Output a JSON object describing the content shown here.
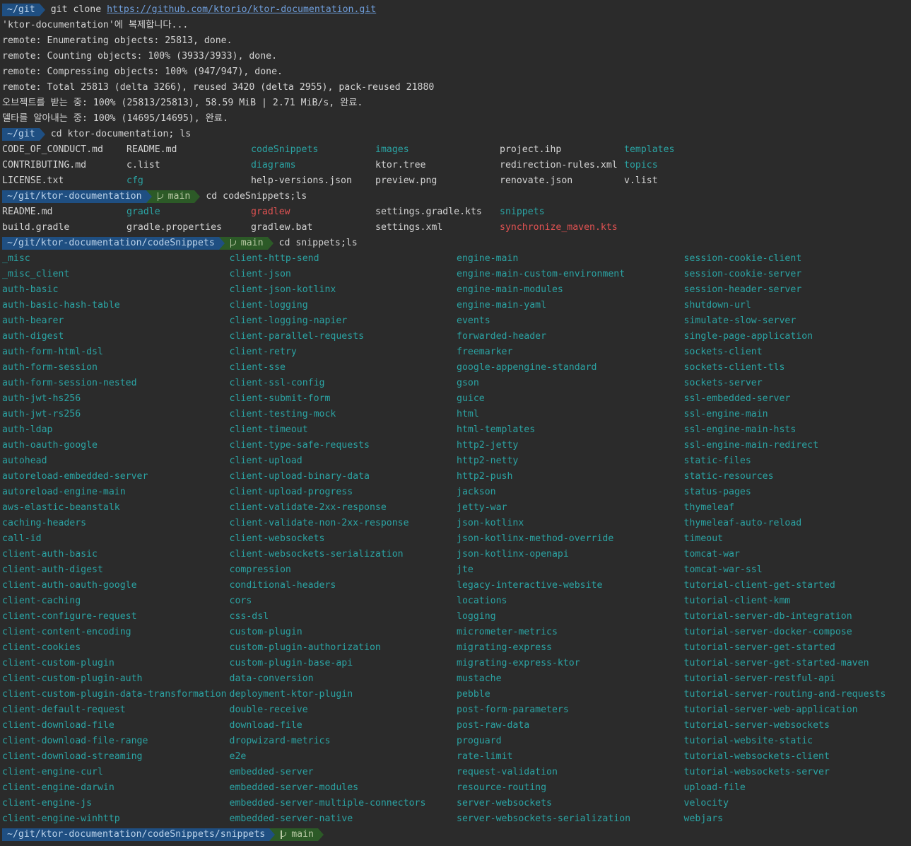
{
  "colors": {
    "background": "#2b2b2b",
    "text": "#d4d4d4",
    "directory": "#2ba3a3",
    "executable": "#e05252",
    "prompt_path_bg": "#1f4f82",
    "prompt_branch_bg": "#2c5a27",
    "url": "#6f9edb"
  },
  "block1": {
    "prompt_path": "~/git",
    "command": "git clone ",
    "url": "https://github.com/ktorio/ktor-documentation.git",
    "output": [
      "'ktor-documentation'에 복제합니다...",
      "remote: Enumerating objects: 25813, done.",
      "remote: Counting objects: 100% (3933/3933), done.",
      "remote: Compressing objects: 100% (947/947), done.",
      "remote: Total 25813 (delta 3266), reused 3420 (delta 2955), pack-reused 21880",
      "오브젝트를 받는 중: 100% (25813/25813), 58.59 MiB | 2.71 MiB/s, 완료.",
      "델타를 알아내는 중: 100% (14695/14695), 완료."
    ]
  },
  "block2": {
    "prompt_path": "~/git",
    "command": "cd ktor-documentation; ls",
    "rows": [
      [
        {
          "name": "CODE_OF_CONDUCT.md",
          "type": "plain"
        },
        {
          "name": "README.md",
          "type": "plain"
        },
        {
          "name": "codeSnippets",
          "type": "dir"
        },
        {
          "name": "images",
          "type": "dir"
        },
        {
          "name": "project.ihp",
          "type": "plain"
        },
        {
          "name": "templates",
          "type": "dir"
        }
      ],
      [
        {
          "name": "CONTRIBUTING.md",
          "type": "plain"
        },
        {
          "name": "c.list",
          "type": "plain"
        },
        {
          "name": "diagrams",
          "type": "dir"
        },
        {
          "name": "ktor.tree",
          "type": "plain"
        },
        {
          "name": "redirection-rules.xml",
          "type": "plain"
        },
        {
          "name": "topics",
          "type": "dir"
        }
      ],
      [
        {
          "name": "LICENSE.txt",
          "type": "plain"
        },
        {
          "name": "cfg",
          "type": "dir"
        },
        {
          "name": "help-versions.json",
          "type": "plain"
        },
        {
          "name": "preview.png",
          "type": "plain"
        },
        {
          "name": "renovate.json",
          "type": "plain"
        },
        {
          "name": "v.list",
          "type": "plain"
        }
      ]
    ]
  },
  "block3": {
    "prompt_path": "~/git/ktor-documentation",
    "branch": "main",
    "command": "cd codeSnippets;ls",
    "rows": [
      [
        {
          "name": "README.md",
          "type": "plain"
        },
        {
          "name": "gradle",
          "type": "dir"
        },
        {
          "name": "gradlew",
          "type": "exec"
        },
        {
          "name": "settings.gradle.kts",
          "type": "plain"
        },
        {
          "name": "snippets",
          "type": "dir"
        }
      ],
      [
        {
          "name": "build.gradle",
          "type": "plain"
        },
        {
          "name": "gradle.properties",
          "type": "plain"
        },
        {
          "name": "gradlew.bat",
          "type": "plain"
        },
        {
          "name": "settings.xml",
          "type": "plain"
        },
        {
          "name": "synchronize_maven.kts",
          "type": "exec"
        }
      ]
    ]
  },
  "block4": {
    "prompt_path": "~/git/ktor-documentation/codeSnippets",
    "branch": "main",
    "command": "cd snippets;ls",
    "columns": [
      [
        "_misc",
        "_misc_client",
        "auth-basic",
        "auth-basic-hash-table",
        "auth-bearer",
        "auth-digest",
        "auth-form-html-dsl",
        "auth-form-session",
        "auth-form-session-nested",
        "auth-jwt-hs256",
        "auth-jwt-rs256",
        "auth-ldap",
        "auth-oauth-google",
        "autohead",
        "autoreload-embedded-server",
        "autoreload-engine-main",
        "aws-elastic-beanstalk",
        "caching-headers",
        "call-id",
        "client-auth-basic",
        "client-auth-digest",
        "client-auth-oauth-google",
        "client-caching",
        "client-configure-request",
        "client-content-encoding",
        "client-cookies",
        "client-custom-plugin",
        "client-custom-plugin-auth",
        "client-custom-plugin-data-transformation",
        "client-default-request",
        "client-download-file",
        "client-download-file-range",
        "client-download-streaming",
        "client-engine-curl",
        "client-engine-darwin",
        "client-engine-js",
        "client-engine-winhttp"
      ],
      [
        "client-http-send",
        "client-json",
        "client-json-kotlinx",
        "client-logging",
        "client-logging-napier",
        "client-parallel-requests",
        "client-retry",
        "client-sse",
        "client-ssl-config",
        "client-submit-form",
        "client-testing-mock",
        "client-timeout",
        "client-type-safe-requests",
        "client-upload",
        "client-upload-binary-data",
        "client-upload-progress",
        "client-validate-2xx-response",
        "client-validate-non-2xx-response",
        "client-websockets",
        "client-websockets-serialization",
        "compression",
        "conditional-headers",
        "cors",
        "css-dsl",
        "custom-plugin",
        "custom-plugin-authorization",
        "custom-plugin-base-api",
        "data-conversion",
        "deployment-ktor-plugin",
        "double-receive",
        "download-file",
        "dropwizard-metrics",
        "e2e",
        "embedded-server",
        "embedded-server-modules",
        "embedded-server-multiple-connectors",
        "embedded-server-native"
      ],
      [
        "engine-main",
        "engine-main-custom-environment",
        "engine-main-modules",
        "engine-main-yaml",
        "events",
        "forwarded-header",
        "freemarker",
        "google-appengine-standard",
        "gson",
        "guice",
        "html",
        "html-templates",
        "http2-jetty",
        "http2-netty",
        "http2-push",
        "jackson",
        "jetty-war",
        "json-kotlinx",
        "json-kotlinx-method-override",
        "json-kotlinx-openapi",
        "jte",
        "legacy-interactive-website",
        "locations",
        "logging",
        "micrometer-metrics",
        "migrating-express",
        "migrating-express-ktor",
        "mustache",
        "pebble",
        "post-form-parameters",
        "post-raw-data",
        "proguard",
        "rate-limit",
        "request-validation",
        "resource-routing",
        "server-websockets",
        "server-websockets-serialization"
      ],
      [
        "session-cookie-client",
        "session-cookie-server",
        "session-header-server",
        "shutdown-url",
        "simulate-slow-server",
        "single-page-application",
        "sockets-client",
        "sockets-client-tls",
        "sockets-server",
        "ssl-embedded-server",
        "ssl-engine-main",
        "ssl-engine-main-hsts",
        "ssl-engine-main-redirect",
        "static-files",
        "static-resources",
        "status-pages",
        "thymeleaf",
        "thymeleaf-auto-reload",
        "timeout",
        "tomcat-war",
        "tomcat-war-ssl",
        "tutorial-client-get-started",
        "tutorial-client-kmm",
        "tutorial-server-db-integration",
        "tutorial-server-docker-compose",
        "tutorial-server-get-started",
        "tutorial-server-get-started-maven",
        "tutorial-server-restful-api",
        "tutorial-server-routing-and-requests",
        "tutorial-server-web-application",
        "tutorial-server-websockets",
        "tutorial-website-static",
        "tutorial-websockets-client",
        "tutorial-websockets-server",
        "upload-file",
        "velocity",
        "webjars"
      ]
    ]
  },
  "final_prompt": {
    "prompt_path": "~/git/ktor-documentation/codeSnippets/snippets",
    "branch": "main"
  }
}
